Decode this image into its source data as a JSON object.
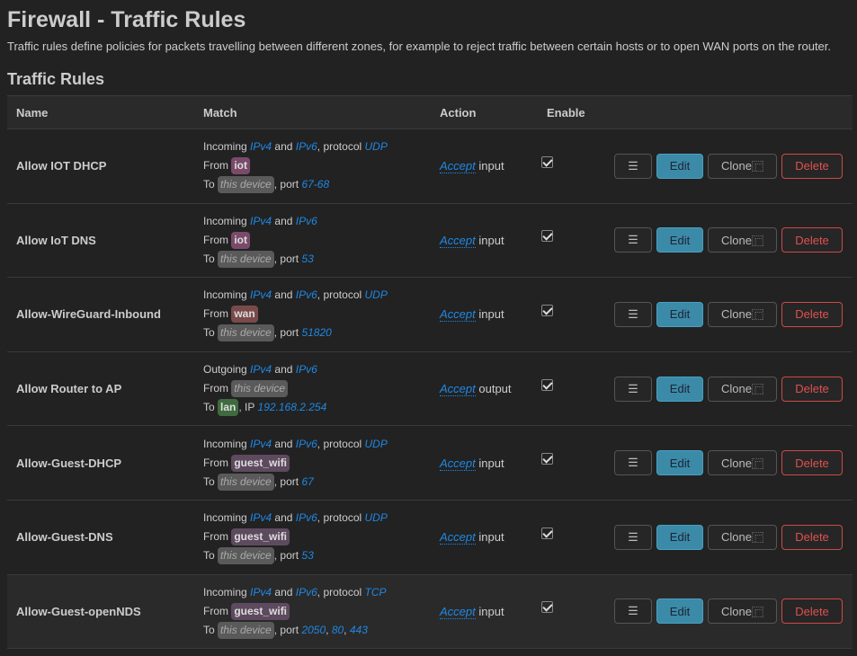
{
  "title": "Firewall - Traffic Rules",
  "description": "Traffic rules define policies for packets travelling between different zones, for example to reject traffic between certain hosts or to open WAN ports on the router.",
  "section_title": "Traffic Rules",
  "columns": [
    "Name",
    "Match",
    "Action",
    "Enable"
  ],
  "buttons": {
    "menu": "☰",
    "edit": "Edit",
    "clone": "Clone",
    "clone_glyph": "⿸",
    "delete": "Delete"
  },
  "zone_colors": {
    "iot": "#7a4a6a",
    "wan": "#7a4a4a",
    "lan": "#3f6b3f",
    "guest_wifi": "#5e4a5e"
  },
  "words": {
    "and": "and",
    "protocol": ", protocol",
    "from": "From",
    "to": "To",
    "port": ", port",
    "ip": ", IP",
    "this_device": "this device"
  },
  "rules": [
    {
      "name": "Allow IOT DHCP",
      "dir": "Incoming",
      "fam": [
        "IPv4",
        "IPv6"
      ],
      "proto": [
        "UDP"
      ],
      "from": "iot",
      "to": "this device",
      "kind": "port",
      "vals": [
        "67-68"
      ],
      "action": "Accept",
      "target": "input",
      "enabled": true
    },
    {
      "name": "Allow IoT DNS",
      "dir": "Incoming",
      "fam": [
        "IPv4",
        "IPv6"
      ],
      "proto": [],
      "from": "iot",
      "to": "this device",
      "kind": "port",
      "vals": [
        "53"
      ],
      "action": "Accept",
      "target": "input",
      "enabled": true
    },
    {
      "name": "Allow-WireGuard-Inbound",
      "dir": "Incoming",
      "fam": [
        "IPv4",
        "IPv6"
      ],
      "proto": [
        "UDP"
      ],
      "from": "wan",
      "to": "this device",
      "kind": "port",
      "vals": [
        "51820"
      ],
      "action": "Accept",
      "target": "input",
      "enabled": true
    },
    {
      "name": "Allow Router to AP",
      "dir": "Outgoing",
      "fam": [
        "IPv4",
        "IPv6"
      ],
      "proto": [],
      "from": "this device",
      "to": "lan",
      "kind": "ip",
      "vals": [
        "192.168.2.254"
      ],
      "action": "Accept",
      "target": "output",
      "enabled": true
    },
    {
      "name": "Allow-Guest-DHCP",
      "dir": "Incoming",
      "fam": [
        "IPv4",
        "IPv6"
      ],
      "proto": [
        "UDP"
      ],
      "from": "guest_wifi",
      "to": "this device",
      "kind": "port",
      "vals": [
        "67"
      ],
      "action": "Accept",
      "target": "input",
      "enabled": true
    },
    {
      "name": "Allow-Guest-DNS",
      "dir": "Incoming",
      "fam": [
        "IPv4",
        "IPv6"
      ],
      "proto": [
        "UDP"
      ],
      "from": "guest_wifi",
      "to": "this device",
      "kind": "port",
      "vals": [
        "53"
      ],
      "action": "Accept",
      "target": "input",
      "enabled": true
    },
    {
      "name": "Allow-Guest-openNDS",
      "dir": "Incoming",
      "fam": [
        "IPv4",
        "IPv6"
      ],
      "proto": [
        "TCP"
      ],
      "from": "guest_wifi",
      "to": "this device",
      "kind": "port",
      "vals": [
        "2050",
        "80",
        "443"
      ],
      "action": "Accept",
      "target": "input",
      "enabled": true
    }
  ]
}
